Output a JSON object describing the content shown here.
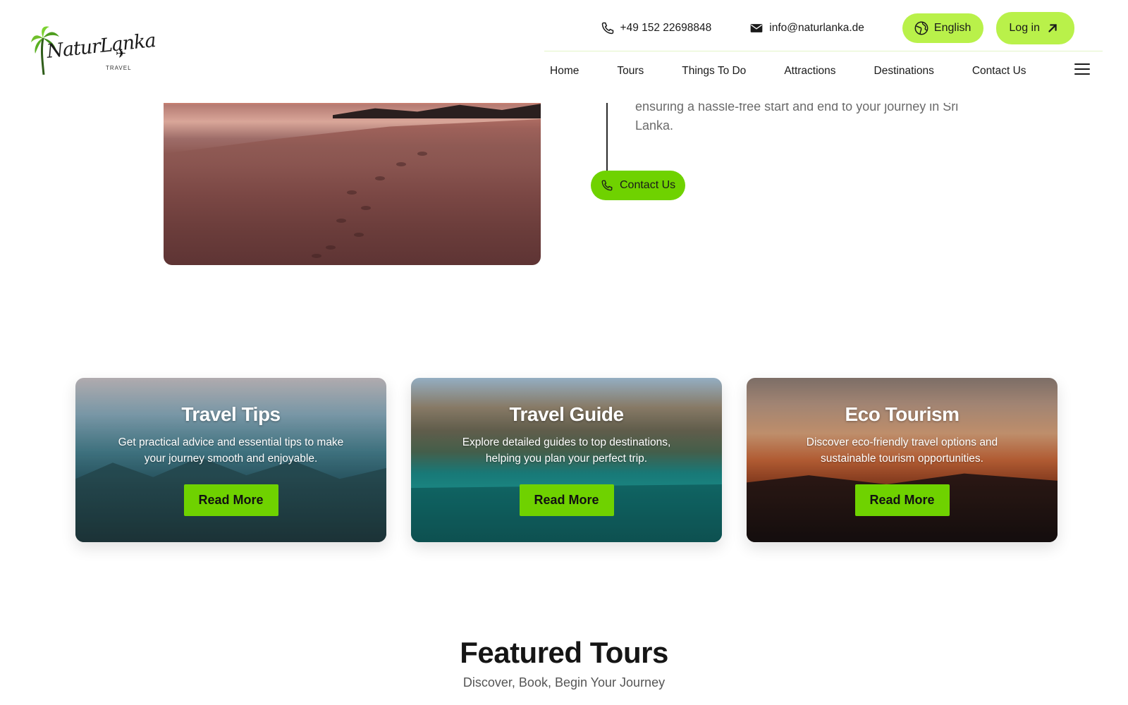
{
  "header": {
    "phone": "+49 152 22698848",
    "email": "info@naturlanka.de",
    "language_label": "English",
    "login_label": "Log in",
    "logo": {
      "text": "NaturLanka",
      "sub": "TRAVEL"
    },
    "nav": [
      "Home",
      "Tours",
      "Things To Do",
      "Attractions",
      "Destinations",
      "Contact Us"
    ]
  },
  "hero": {
    "text": "ensuring a hassle-free start and end to your journey in Sri Lanka.",
    "contact_button": "Contact Us"
  },
  "cards": [
    {
      "title": "Travel Tips",
      "description": "Get practical advice and essential tips to make your journey smooth and enjoyable.",
      "button": "Read More"
    },
    {
      "title": "Travel Guide",
      "description": "Explore detailed guides to top destinations, helping you plan your perfect trip.",
      "button": "Read More"
    },
    {
      "title": "Eco Tourism",
      "description": "Discover eco-friendly travel options and sustainable tourism opportunities.",
      "button": "Read More"
    }
  ],
  "featured": {
    "title": "Featured Tours",
    "subtitle": "Discover, Book, Begin Your Journey"
  },
  "colors": {
    "accent_light": "#b9f14a",
    "accent": "#6fd200",
    "text": "#1a1a1a",
    "muted": "#6b6b6b"
  },
  "icons": {
    "phone": "phone-icon",
    "email": "mail-icon",
    "language": "globe-icon",
    "login": "arrow-up-right-icon",
    "menu": "hamburger-menu-icon"
  }
}
